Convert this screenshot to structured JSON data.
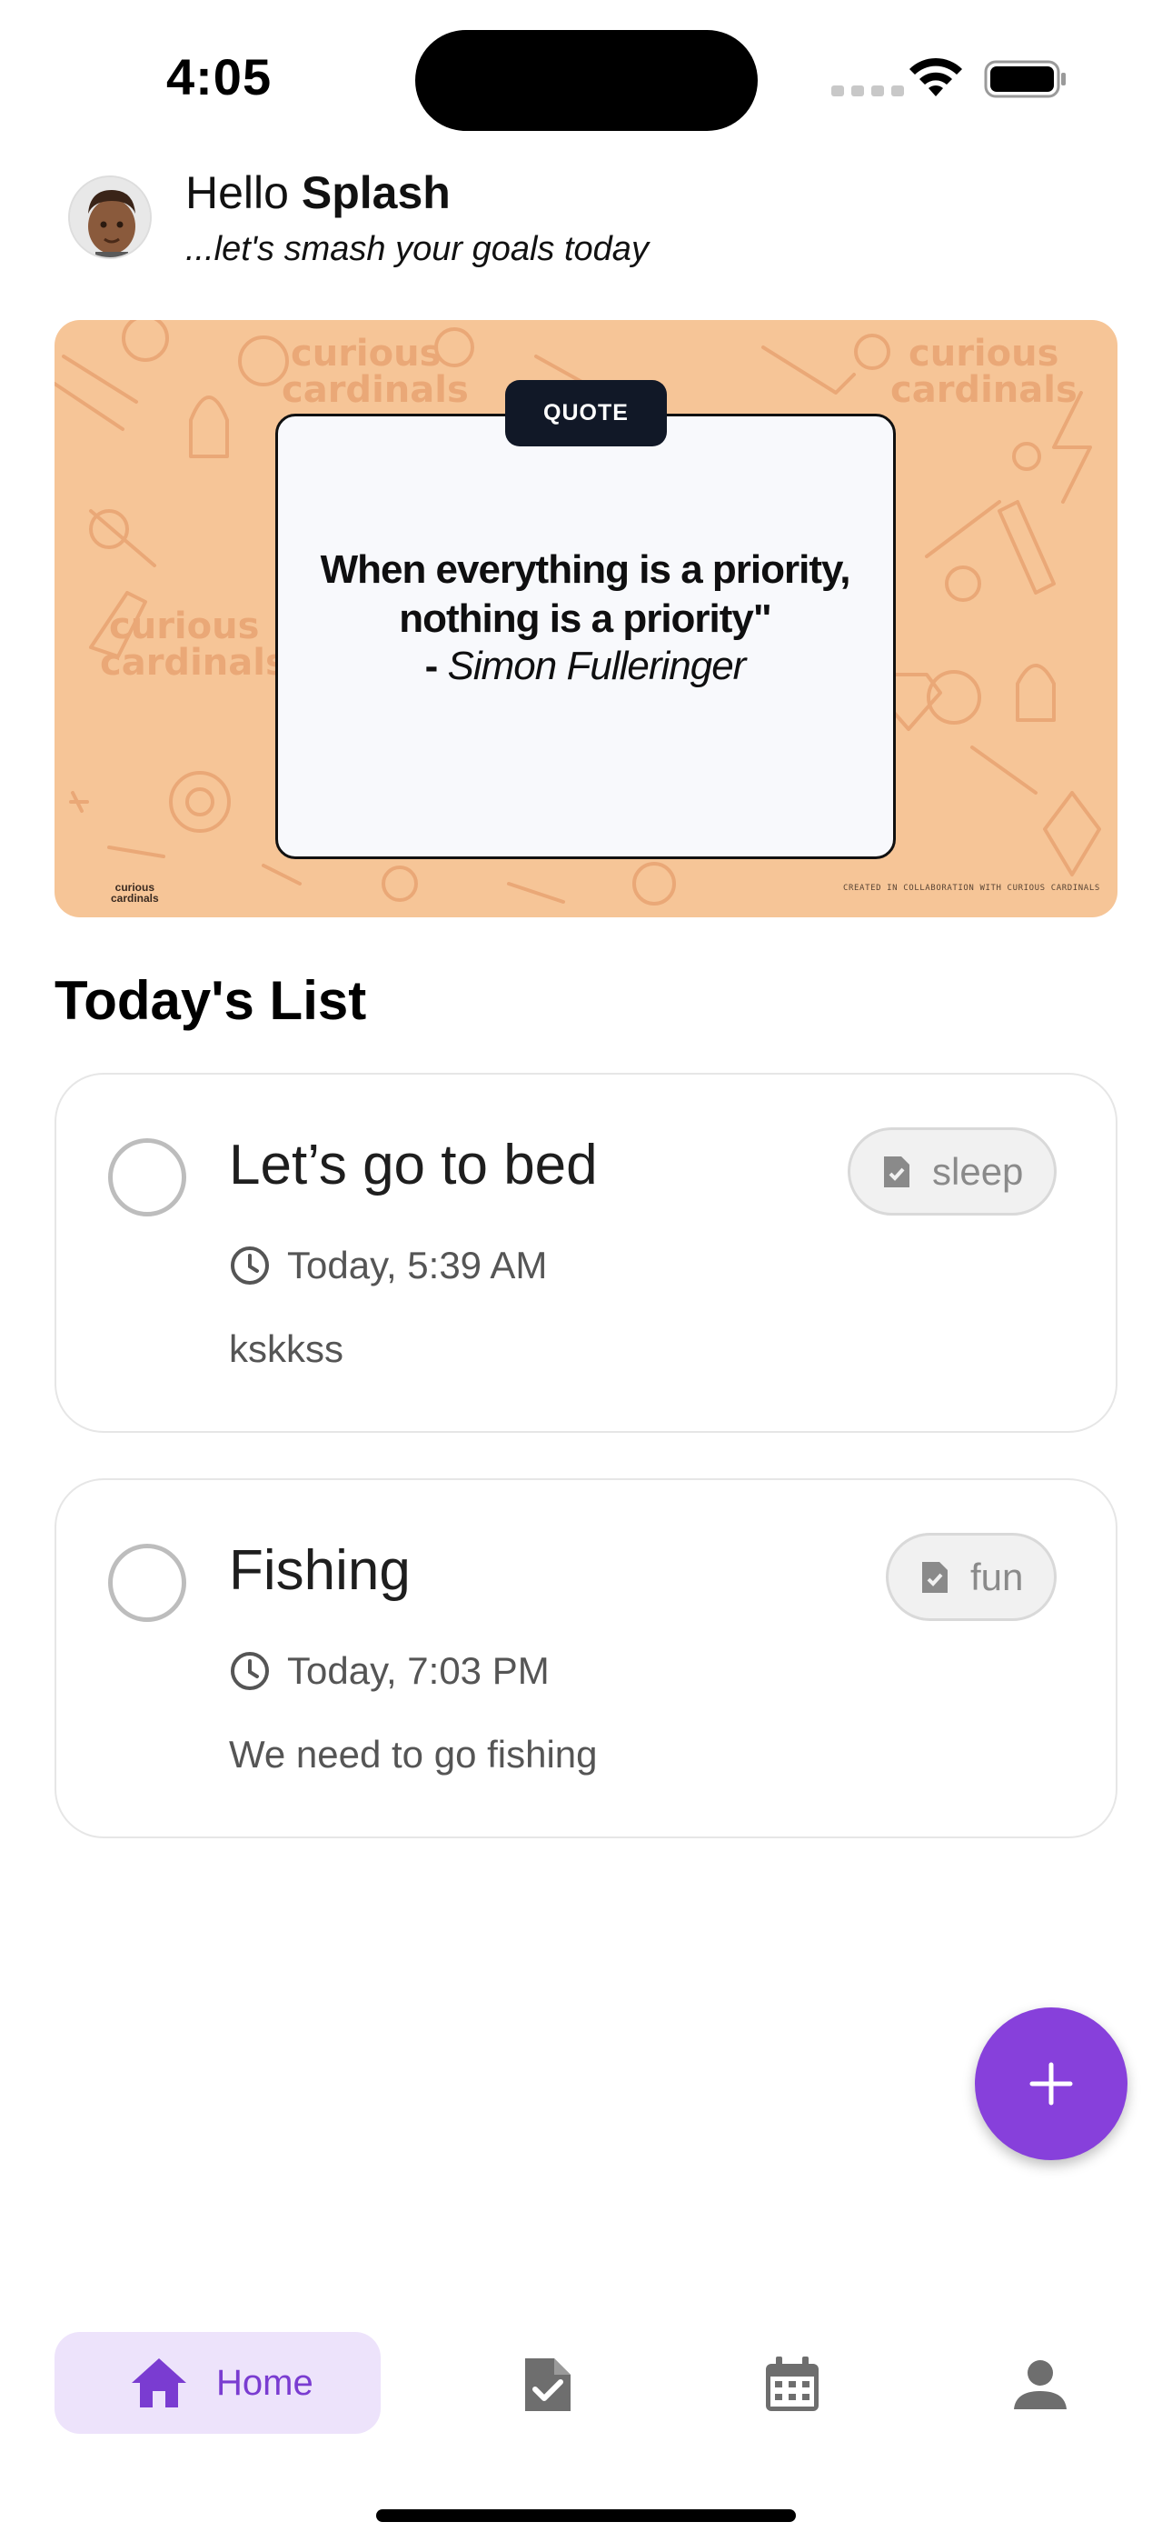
{
  "status_bar": {
    "time": "4:05"
  },
  "header": {
    "greeting_prefix": "Hello",
    "user_name": "Splash",
    "subtitle": "...let's smash your goals today"
  },
  "banner": {
    "tag": "QUOTE",
    "quote": "When everything is a priority, nothing is a priority\"",
    "author_prefix": "-",
    "author": "Simon Fulleringer",
    "brand_line1": "curious",
    "brand_line2": "cardinals",
    "credit": "CREATED IN COLLABORATION WITH CURIOUS CARDINALS",
    "colors": {
      "background": "#f6c597",
      "pattern": "#eaa877",
      "card": "#f8f9fc",
      "tag_bg": "#111827"
    }
  },
  "list": {
    "title": "Today's List",
    "tasks": [
      {
        "title": "Let’s go to bed",
        "time": "Today, 5:39 AM",
        "note": "kskkss",
        "tag": "sleep",
        "tag_icon": "document-check-icon",
        "done": false
      },
      {
        "title": "Fishing",
        "time": "Today, 7:03 PM",
        "note": "We need to go fishing",
        "tag": "fun",
        "tag_icon": "document-check-icon",
        "done": false
      }
    ]
  },
  "fab": {
    "icon": "plus-icon",
    "color": "#8740db"
  },
  "bottom_nav": {
    "items": [
      {
        "label": "Home",
        "icon": "home-icon",
        "active": true
      },
      {
        "label": "",
        "icon": "tasks-icon",
        "active": false
      },
      {
        "label": "",
        "icon": "calendar-icon",
        "active": false
      },
      {
        "label": "",
        "icon": "profile-icon",
        "active": false
      }
    ],
    "active_color": "#7a3cd1",
    "active_bg": "#ede3fb"
  }
}
